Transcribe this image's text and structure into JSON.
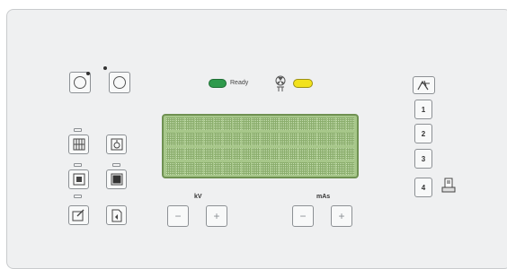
{
  "status": {
    "ready_label": "Ready",
    "ready_color": "#2e9a4c",
    "warning_color": "#f2e21c"
  },
  "display": {
    "rows": 4,
    "columns": 20,
    "color": "#a7c78a"
  },
  "exposure": {
    "kv_label": "kV",
    "mas_label": "mAs",
    "minus": "−",
    "plus": "+"
  },
  "programs": [
    "1",
    "2",
    "3",
    "4"
  ],
  "icons": {
    "ring_off": "ring-button-icon",
    "ring_with_dot": "ring-button-icon",
    "grid": "grid-icon",
    "tube_filter": "filter-icon",
    "small_field": "small-focus-icon",
    "large_field": "large-focus-icon",
    "image_edit": "image-edit-icon",
    "document": "document-icon",
    "body_region": "body-region-icon",
    "radiation": "radiation-icon",
    "printer": "printer-icon"
  }
}
